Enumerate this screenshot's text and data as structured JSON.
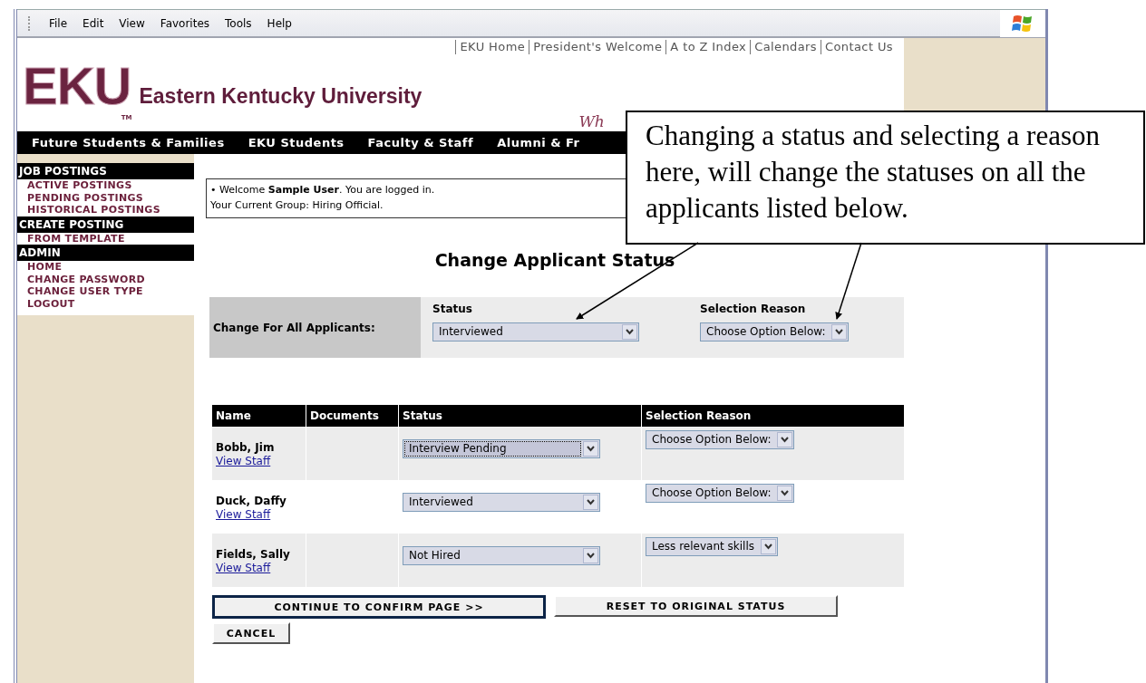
{
  "menu_bar": {
    "items": [
      "File",
      "Edit",
      "View",
      "Favorites",
      "Tools",
      "Help"
    ]
  },
  "header": {
    "top_links": [
      "EKU Home",
      "President's Welcome",
      "A to Z Index",
      "Calendars",
      "Contact Us"
    ],
    "logo": "EKU",
    "logo_mark": "TM",
    "university": "Eastern Kentucky University",
    "tagline": "Wh",
    "nav": [
      "Future Students & Families",
      "EKU Students",
      "Faculty & Staff",
      "Alumni & Fr"
    ]
  },
  "sidebar": {
    "sections": [
      {
        "title": "JOB POSTINGS",
        "items": [
          "ACTIVE POSTINGS",
          "PENDING POSTINGS",
          "HISTORICAL POSTINGS"
        ]
      },
      {
        "title": "CREATE POSTING",
        "items": [
          "FROM TEMPLATE"
        ]
      },
      {
        "title": "ADMIN",
        "items": [
          "HOME",
          "CHANGE PASSWORD",
          "CHANGE USER TYPE",
          "LOGOUT"
        ]
      }
    ]
  },
  "welcome": {
    "line1": "• Welcome **Sample User**. You are logged in.",
    "line2": "Your Current Group: Hiring Official."
  },
  "page_title": "Change Applicant Status",
  "change_all": {
    "label": "Change For All Applicants:",
    "status_label": "Status",
    "status_value": "Interviewed",
    "reason_label": "Selection Reason",
    "reason_value": "Choose Option Below:"
  },
  "table": {
    "columns": [
      "Name",
      "Documents",
      "Status",
      "Selection Reason"
    ],
    "rows": [
      {
        "name": "Bobb, Jim",
        "link": "View Staff",
        "status": "Interview Pending",
        "focused": true,
        "reason": "Choose Option Below:"
      },
      {
        "name": "Duck, Daffy",
        "link": "View Staff",
        "status": "Interviewed",
        "focused": false,
        "reason": "Choose Option Below:"
      },
      {
        "name": "Fields, Sally",
        "link": "View Staff",
        "status": "Not Hired",
        "focused": false,
        "reason": "Less relevant skills"
      }
    ]
  },
  "buttons": [
    {
      "label": "CONTINUE TO CONFIRM PAGE >>",
      "selected": true
    },
    {
      "label": "RESET TO ORIGINAL STATUS",
      "selected": false
    },
    {
      "label": "CANCEL",
      "selected": false
    }
  ],
  "callout": {
    "text": "Changing a status and selecting a reason here, will change the statuses on all the applicants listed below."
  }
}
